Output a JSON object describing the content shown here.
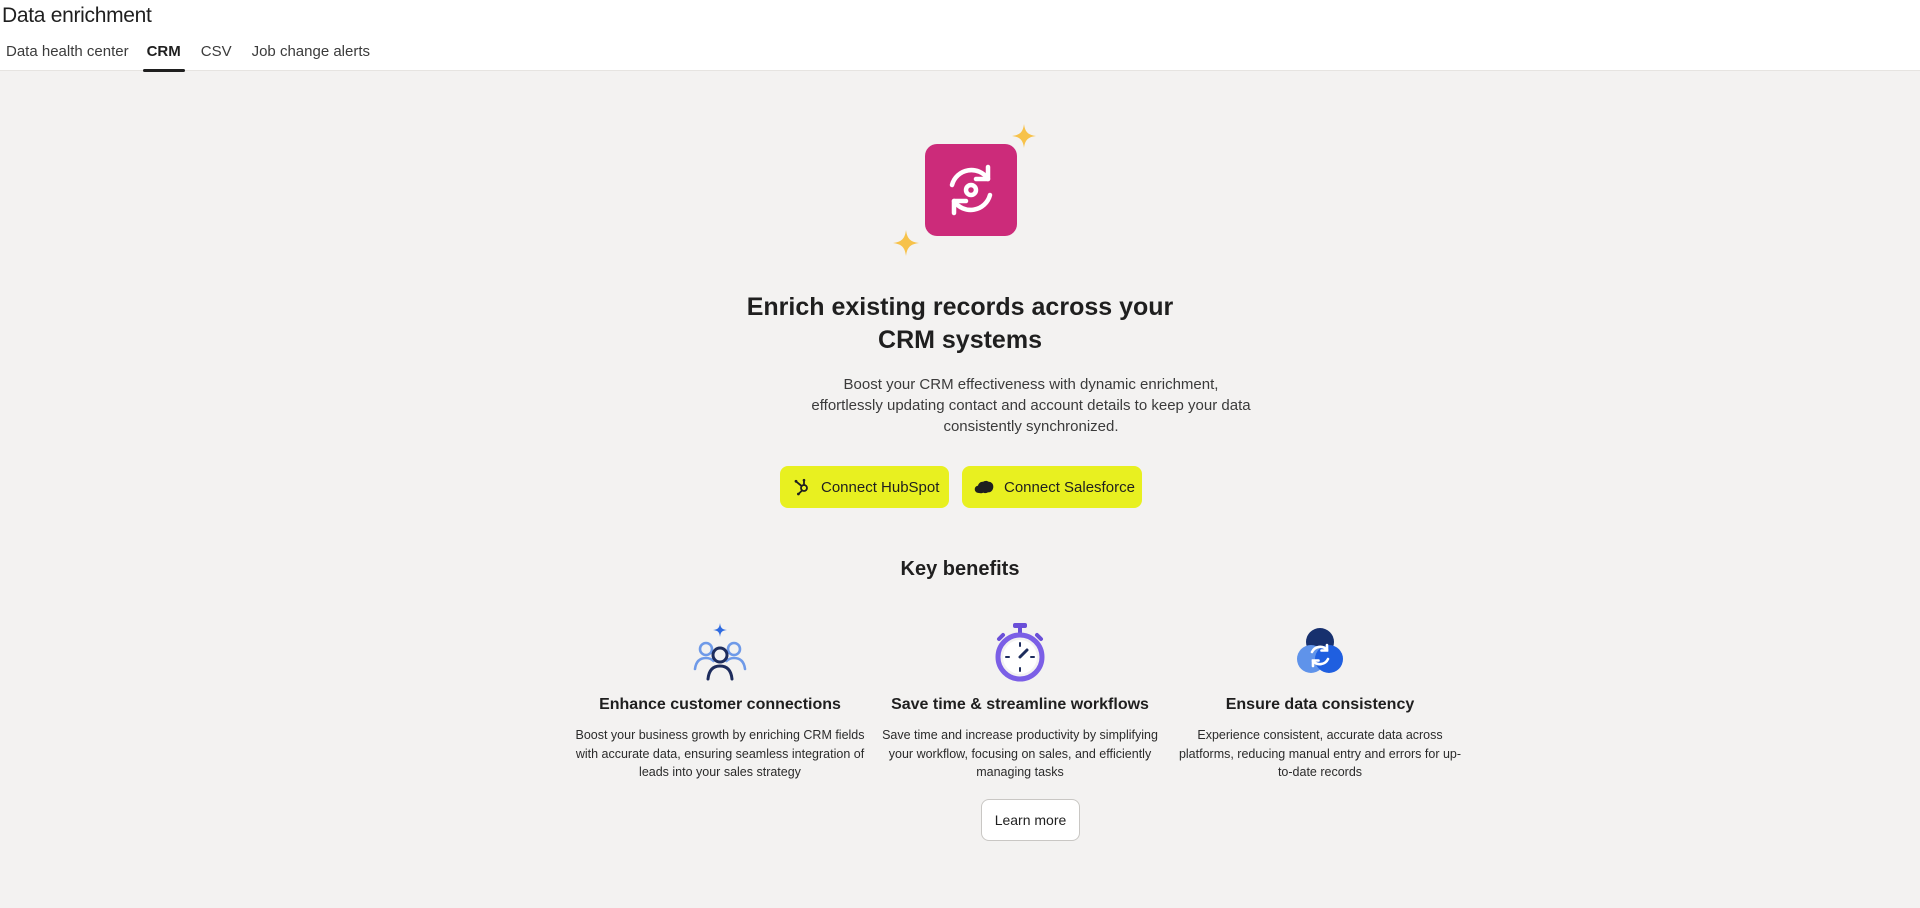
{
  "header": {
    "title": "Data enrichment",
    "tabs": [
      {
        "label": "Data health center",
        "active": false
      },
      {
        "label": "CRM",
        "active": true
      },
      {
        "label": "CSV",
        "active": false
      },
      {
        "label": "Job change alerts",
        "active": false
      }
    ]
  },
  "hero": {
    "icon": "refresh-sync-icon",
    "icon_color": "#cc2b7a",
    "sparkle_color": "#f7c24a",
    "headline_line1": "Enrich existing records across your",
    "headline_line2": "CRM systems",
    "description": "Boost your CRM effectiveness with dynamic enrichment, effortlessly updating contact and account details to keep your data consistently synchronized."
  },
  "actions": {
    "hubspot_label": "Connect HubSpot",
    "hubspot_icon": "hubspot-icon",
    "salesforce_label": "Connect Salesforce",
    "salesforce_icon": "salesforce-cloud-icon",
    "button_color": "#e8f020"
  },
  "benefits": {
    "title": "Key benefits",
    "items": [
      {
        "icon": "people-sparkle-icon",
        "title": "Enhance customer connections",
        "text": "Boost your business growth by enriching CRM fields with accurate data, ensuring seamless integration of leads into your sales strategy"
      },
      {
        "icon": "stopwatch-icon",
        "title": "Save time & streamline workflows",
        "text": "Save time and increase productivity by simplifying your workflow, focusing on sales, and efficiently managing tasks"
      },
      {
        "icon": "sync-circles-icon",
        "title": "Ensure data consistency",
        "text": "Experience consistent, accurate data across platforms, reducing manual entry and errors for up-to-date records"
      }
    ],
    "learn_more_label": "Learn more"
  }
}
